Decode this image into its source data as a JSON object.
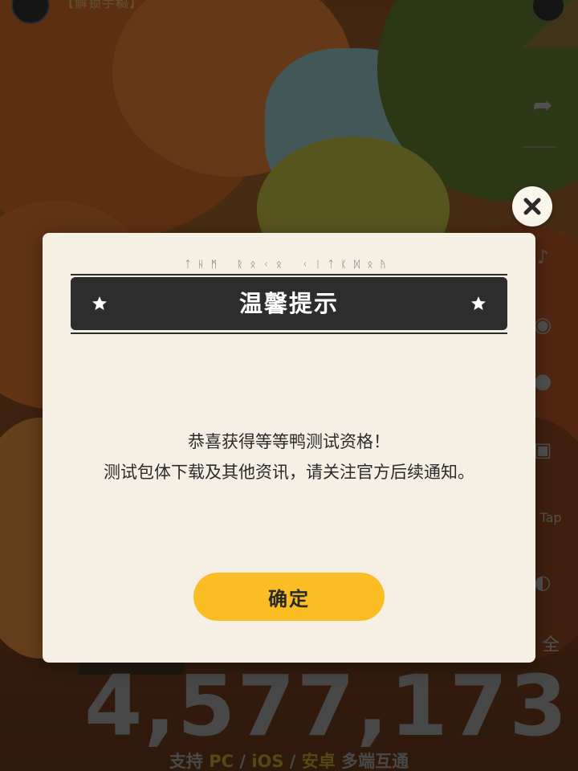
{
  "background": {
    "top_text": "【解锁手稿】",
    "counter": "4,577,173",
    "platform_line": {
      "prefix": "支持 ",
      "pc": "PC",
      "sep1": " / ",
      "ios": "iOS",
      "sep2": " / ",
      "android": "安卓",
      "suffix": " 多端互通"
    },
    "side_badges": {
      "tap": "Tap",
      "char": "全"
    }
  },
  "dialog": {
    "subtitle": "ᛏᚺᛗ ᚱᛟᚲᛟ ᚲᛁᛏᛕᛞᛟᚤ",
    "title": "温馨提示",
    "message_line1": "恭喜获得等等鸭测试资格！",
    "message_line2": "测试包体下载及其他资讯，请关注官方后续通知。",
    "confirm_label": "确定"
  },
  "icons": {
    "close": "close-icon",
    "star": "star-icon"
  },
  "colors": {
    "dialog_bg": "#f6f0e4",
    "title_bar": "#2d2d2d",
    "confirm_button": "#fbbd24",
    "close_button_bg": "#fbf6ec"
  }
}
